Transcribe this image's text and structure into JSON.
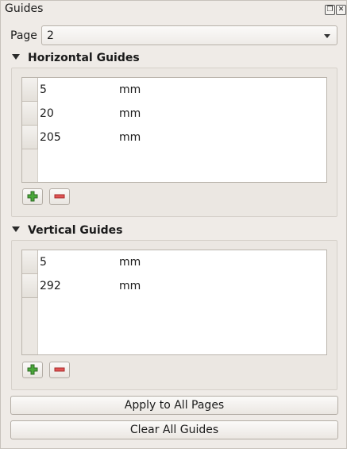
{
  "panel": {
    "title": "Guides"
  },
  "page": {
    "label": "Page",
    "value": "2"
  },
  "horizontal": {
    "title": "Horizontal Guides",
    "rows": [
      {
        "value": "5",
        "unit": "mm"
      },
      {
        "value": "20",
        "unit": "mm"
      },
      {
        "value": "205",
        "unit": "mm"
      }
    ]
  },
  "vertical": {
    "title": "Vertical Guides",
    "rows": [
      {
        "value": "5",
        "unit": "mm"
      },
      {
        "value": "292",
        "unit": "mm"
      }
    ]
  },
  "buttons": {
    "apply_all": "Apply to All Pages",
    "clear_all": "Clear All Guides"
  },
  "colors": {
    "add_icon": "#3a8a2e",
    "remove_icon": "#d64545"
  },
  "icons": {
    "float": "float-icon",
    "close": "close-icon",
    "add": "plus-icon",
    "remove": "minus-icon"
  }
}
